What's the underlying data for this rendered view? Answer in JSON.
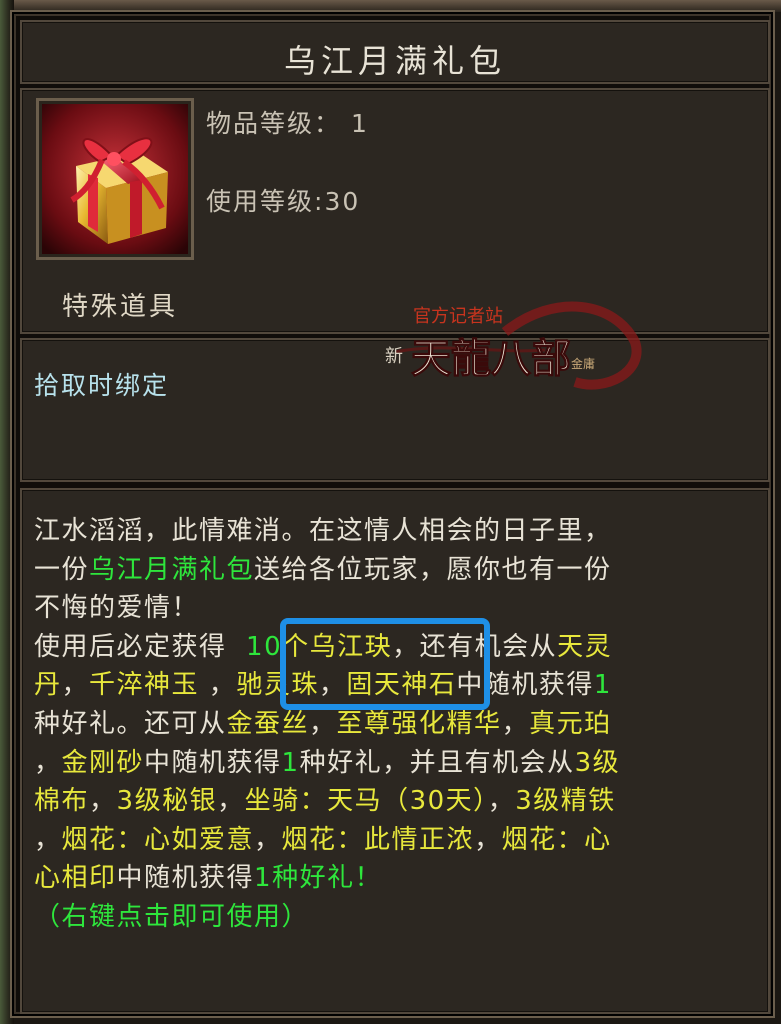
{
  "item": {
    "title": "乌江月满礼包",
    "item_level_label": "物品等级：",
    "item_level_value": "1",
    "use_level_label": "使用等级",
    "use_level_value": ":30",
    "category": "特殊道具",
    "binding": "拾取时绑定"
  },
  "watermark": {
    "top": "官方记者站",
    "main": "天龍八部",
    "prefix": "新",
    "suffix": "金庸"
  },
  "description": {
    "l1": "江水滔滔，此情难消。在这情人相会的日子里，",
    "l2a": "一份",
    "l2b": "乌江月满礼包",
    "l2c": "送给各位玩家，愿你也有一份",
    "l3": "不悔的爱情！",
    "l4a": "使用后必定获得  ",
    "l4b": "10",
    "l4c": "个乌江玦",
    "l4d": "，还有机会从",
    "l4e": "天灵",
    "l5a": "丹",
    "l5b": "，",
    "l5c": "千淬神玉",
    "l5d": " ，",
    "l5e": "驰灵珠",
    "l5f": "，",
    "l5g": "固天神石",
    "l5h": "中随机获得",
    "l5i": "1",
    "l6a": "种好礼。还可从",
    "l6b": "金蚕丝",
    "l6c": "，",
    "l6d": "至尊强化精华",
    "l6e": "，",
    "l6f": "真元珀",
    "l7a": "，",
    "l7b": "金刚砂",
    "l7c": "中随机获得",
    "l7d": "1",
    "l7e": "种好礼，并且有机会从",
    "l7f": "3级",
    "l8a": "棉布",
    "l8b": "，",
    "l8c": "3级秘银",
    "l8d": "，",
    "l8e": "坐骑：天马（30天）",
    "l8f": "，",
    "l8g": "3级精铁",
    "l9a": "，",
    "l9b": "烟花：心如爱意",
    "l9c": "，",
    "l9d": "烟花：此情正浓",
    "l9e": "，",
    "l9f": "烟花：心",
    "l10a": "心相印",
    "l10b": "中随机获得",
    "l10c": "1种好礼！",
    "l11": "（右键点击即可使用）"
  },
  "colors": {
    "highlight_green": "#2ee63c",
    "highlight_yellow": "#e8e83c",
    "binding_blue": "#b8e2ec",
    "annotation_box": "#1e8fe6"
  }
}
